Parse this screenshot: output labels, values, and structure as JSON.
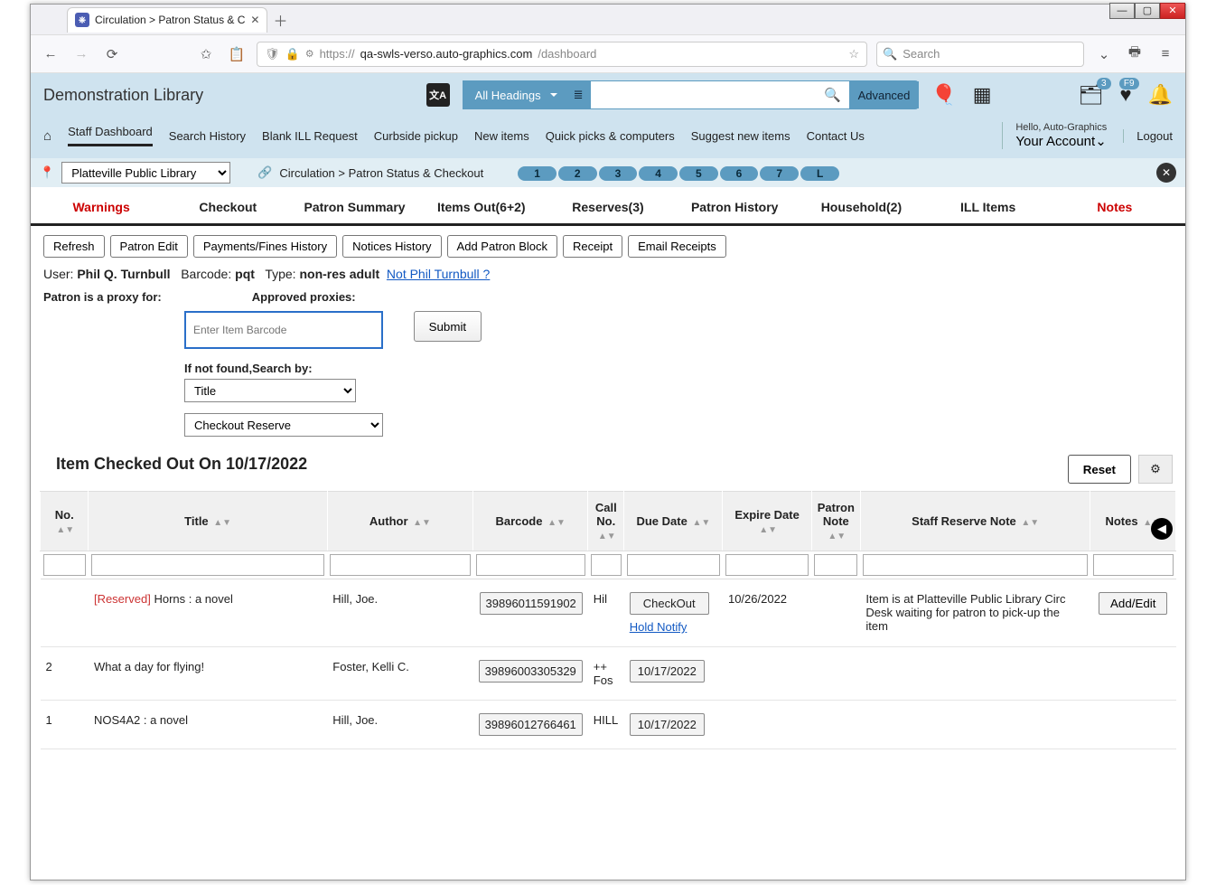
{
  "browser": {
    "tab_title": "Circulation > Patron Status & C",
    "url_prefix": "https://",
    "url_domain": "qa-swls-verso.auto-graphics.com",
    "url_path": "/dashboard",
    "search_placeholder": "Search"
  },
  "header": {
    "app_title": "Demonstration Library",
    "all_headings": "All Headings",
    "advanced": "Advanced",
    "greeting": "Hello, Auto-Graphics",
    "account": "Your Account",
    "logout": "Logout",
    "cart_badge": "3",
    "heart_badge": "F9"
  },
  "nav": {
    "items": [
      "Staff Dashboard",
      "Search History",
      "Blank ILL Request",
      "Curbside pickup",
      "New items",
      "Quick picks & computers",
      "Suggest new items",
      "Contact Us"
    ]
  },
  "loc": {
    "library": "Platteville Public Library",
    "crumb1": "Circulation",
    "crumb2": "Patron Status & Checkout",
    "pills": [
      "1",
      "2",
      "3",
      "4",
      "5",
      "6",
      "7",
      "L"
    ]
  },
  "subtabs": {
    "items": [
      {
        "label": "Warnings",
        "red": true
      },
      {
        "label": "Checkout",
        "red": false
      },
      {
        "label": "Patron Summary",
        "red": false
      },
      {
        "label": "Items Out(6+2)",
        "red": false
      },
      {
        "label": "Reserves(3)",
        "red": false
      },
      {
        "label": "Patron History",
        "red": false
      },
      {
        "label": "Household(2)",
        "red": false
      },
      {
        "label": "ILL Items",
        "red": false
      },
      {
        "label": "Notes",
        "red": true
      }
    ]
  },
  "actions": [
    "Refresh",
    "Patron Edit",
    "Payments/Fines History",
    "Notices History",
    "Add Patron Block",
    "Receipt",
    "Email Receipts"
  ],
  "patron": {
    "user_label": "User:",
    "user_name": "Phil Q. Turnbull",
    "barcode_label": "Barcode:",
    "barcode": "pqt",
    "type_label": "Type:",
    "type": "non-res adult",
    "not_link": "Not Phil Turnbull ?",
    "proxy_for": "Patron is a proxy for:",
    "approved_proxies": "Approved proxies:"
  },
  "form": {
    "barcode_placeholder": "Enter Item Barcode",
    "submit": "Submit",
    "if_not_found": "If not found,Search by:",
    "search_by": "Title",
    "reserve_action": "Checkout Reserve"
  },
  "section": {
    "title": "Item Checked Out On 10/17/2022",
    "reset": "Reset"
  },
  "table": {
    "headers": [
      "No.",
      "Title",
      "Author",
      "Barcode",
      "Call No.",
      "Due Date",
      "Expire Date",
      "Patron Note",
      "Staff Reserve Note",
      "Notes"
    ],
    "rows": [
      {
        "no": "",
        "reserved": "[Reserved]",
        "title": "Horns : a novel",
        "author": "Hill, Joe.",
        "barcode": "39896011591902",
        "call": "Hil",
        "due_type": "checkout",
        "due": "CheckOut",
        "hold": "Hold Notify",
        "expire": "10/26/2022",
        "patron_note": "",
        "staff_note": "Item is at Platteville Public Library Circ Desk waiting for patron to pick-up the item",
        "notes": "Add/Edit"
      },
      {
        "no": "2",
        "reserved": "",
        "title": "What a day for flying!",
        "author": "Foster, Kelli C.",
        "barcode": "39896003305329",
        "call": "++ Fos",
        "due_type": "date",
        "due": "10/17/2022",
        "hold": "",
        "expire": "",
        "patron_note": "",
        "staff_note": "",
        "notes": ""
      },
      {
        "no": "1",
        "reserved": "",
        "title": "NOS4A2 : a novel",
        "author": "Hill, Joe.",
        "barcode": "39896012766461",
        "call": "HILL",
        "due_type": "date",
        "due": "10/17/2022",
        "hold": "",
        "expire": "",
        "patron_note": "",
        "staff_note": "",
        "notes": ""
      }
    ]
  }
}
